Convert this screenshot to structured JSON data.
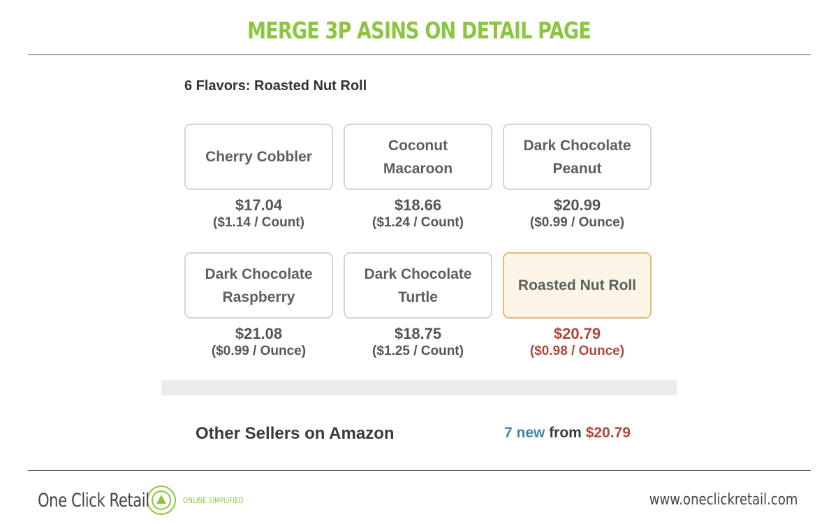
{
  "slide": {
    "title": "MERGE 3P ASINS ON DETAIL PAGE"
  },
  "colors": {
    "title_green": "#8cc63f",
    "selected_bg": "#fbf5e7",
    "selected_border": "#e4b97a",
    "price_red": "#b0473c",
    "link_blue": "#3d86a8"
  },
  "variation": {
    "header": "6 Flavors: Roasted Nut Roll",
    "selected": "Roasted Nut Roll",
    "tiles": [
      {
        "line1": "Cherry Cobbler",
        "line2": "",
        "price": "$17.04",
        "unit_price": "($1.14 / Count)"
      },
      {
        "line1": "Coconut",
        "line2": "Macaroon",
        "price": "$18.66",
        "unit_price": "($1.24 / Count)"
      },
      {
        "line1": "Dark Chocolate",
        "line2": "Peanut",
        "price": "$20.99",
        "unit_price": "($0.99 / Ounce)"
      },
      {
        "line1": "Dark Chocolate",
        "line2": "Raspberry",
        "price": "$21.08",
        "unit_price": "($0.99 / Ounce)"
      },
      {
        "line1": "Dark Chocolate",
        "line2": "Turtle",
        "price": "$18.75",
        "unit_price": "($1.25 / Count)"
      },
      {
        "line1": "Roasted Nut Roll",
        "line2": "",
        "price": "$20.79",
        "unit_price": "($0.98 / Ounce)"
      }
    ]
  },
  "other_sellers": {
    "label": "Other Sellers on Amazon",
    "count_text": "7 new",
    "from_text": " from ",
    "from_price": "$20.79"
  },
  "footer": {
    "brand": "One Click Retail",
    "tagline": "ONLINE SIMPLIFIED",
    "logo_icon": "circled-arrow-up-icon",
    "website": "www.oneclickretail.com"
  }
}
